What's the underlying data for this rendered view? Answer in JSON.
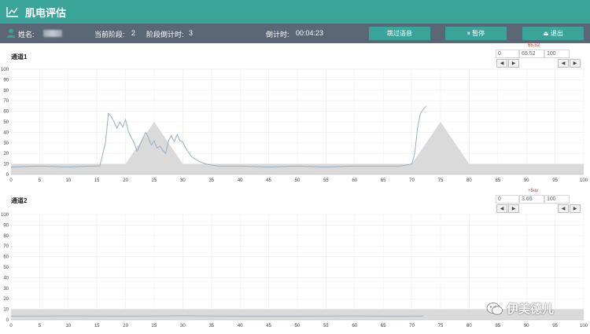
{
  "app": {
    "title": "肌电评估"
  },
  "info": {
    "name_label": "姓名:",
    "stage_label": "当前阶段:",
    "stage_value": "2",
    "stage_countdown_label": "阶段倒计时:",
    "stage_countdown_value": "3",
    "countdown_label": "倒计时:",
    "countdown_value": "00:04:23"
  },
  "buttons": {
    "skip_voice": "跳过语音",
    "pause": "⏸ 暂停",
    "exit": "⏏ 退出"
  },
  "channels": [
    {
      "title": "通道1",
      "min": "0",
      "current": "65.52",
      "max": "100",
      "marker": "65.52",
      "left_arrow": "◀",
      "right_arrow": "▶"
    },
    {
      "title": "通道2",
      "min": "0",
      "current": "3.65",
      "max": "100",
      "marker": "+5uv",
      "left_arrow": "◀",
      "right_arrow": "▶"
    }
  ],
  "axis": {
    "y_ticks": [
      "0",
      "10",
      "20",
      "30",
      "40",
      "50",
      "60",
      "70",
      "80",
      "90",
      "100"
    ],
    "x_ticks": [
      "0",
      "5",
      "10",
      "15",
      "20",
      "25",
      "30",
      "35",
      "40",
      "45",
      "50",
      "55",
      "60",
      "65",
      "70",
      "75",
      "80",
      "85",
      "90",
      "95",
      "100"
    ]
  },
  "chart_data": [
    {
      "type": "line",
      "title": "通道1",
      "xlim": [
        0,
        100
      ],
      "ylim": [
        0,
        100
      ],
      "grid": true,
      "baseline_band": 10,
      "target_peaks": [
        {
          "start": 20,
          "peak": 25,
          "end": 30,
          "height": 50
        },
        {
          "start": 70,
          "peak": 75,
          "end": 80,
          "height": 50
        }
      ],
      "series": [
        {
          "color": "#9ab0c4",
          "x": [
            0,
            5,
            10,
            14,
            15.5,
            16.5,
            17,
            17.5,
            18,
            18.5,
            19,
            19.5,
            20,
            20.5,
            21,
            21.5,
            22,
            22.5,
            23,
            23.5,
            24,
            24.5,
            25,
            25.5,
            26,
            26.5,
            27,
            27.5,
            28,
            28.5,
            29,
            29.5,
            30,
            30.5,
            31,
            31.5,
            32,
            33,
            34,
            35,
            36,
            40,
            45,
            50,
            55,
            60,
            65,
            68,
            69,
            70,
            70.5,
            71,
            71.5,
            72,
            72.5
          ],
          "y": [
            7,
            8,
            7,
            8,
            8,
            30,
            58,
            55,
            50,
            44,
            50,
            45,
            52,
            41,
            35,
            30,
            22,
            28,
            34,
            40,
            35,
            28,
            32,
            25,
            27,
            23,
            20,
            32,
            37,
            31,
            38,
            32,
            31,
            25,
            21,
            17,
            15,
            12,
            10,
            9,
            8,
            8,
            7,
            8,
            7,
            8,
            8,
            8,
            9,
            10,
            20,
            45,
            58,
            62,
            65
          ]
        }
      ]
    },
    {
      "type": "line",
      "title": "通道2",
      "xlim": [
        0,
        100
      ],
      "ylim": [
        0,
        100
      ],
      "grid": true,
      "baseline_band": 10,
      "target_peaks": [],
      "series": [
        {
          "color": "#9ab0c4",
          "x": [
            0,
            10,
            20,
            30,
            40,
            50,
            60,
            65,
            70,
            72
          ],
          "y": [
            3.5,
            3.7,
            3.5,
            3.8,
            3.6,
            3.5,
            3.7,
            3.6,
            3.6,
            3.65
          ]
        }
      ]
    }
  ],
  "watermark": {
    "text": "伊美德儿"
  }
}
